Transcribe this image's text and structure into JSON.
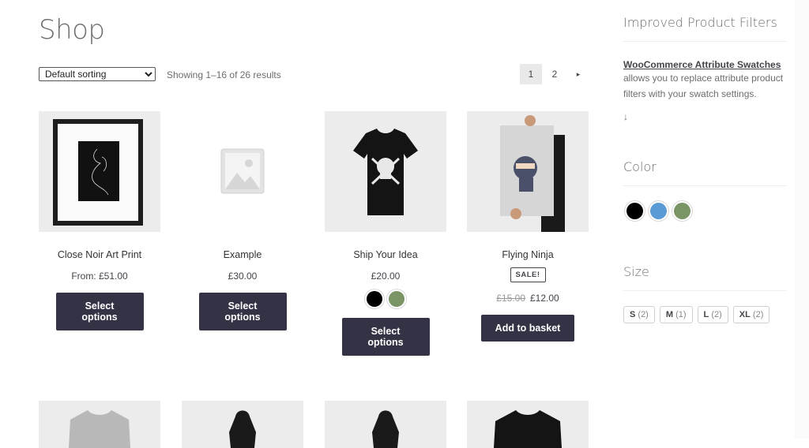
{
  "page": {
    "title": "Shop"
  },
  "toolbar": {
    "sort_selected": "Default sorting",
    "sort_options": [
      "Default sorting"
    ],
    "result_count": "Showing 1–16 of 26 results",
    "pages": [
      "1",
      "2"
    ],
    "next": "▸"
  },
  "products": [
    {
      "title": "Close Noir Art Print",
      "price": "From: £51.00",
      "button": "Select options"
    },
    {
      "title": "Example",
      "price": "£30.00",
      "button": "Select options"
    },
    {
      "title": "Ship Your Idea",
      "price": "£20.00",
      "button": "Select options",
      "swatches": [
        "#000000",
        "#7a9466"
      ]
    },
    {
      "title": "Flying Ninja",
      "badge": "SALE!",
      "old_price": "£15.00",
      "price": "£12.00",
      "button": "Add to basket"
    }
  ],
  "sidebar": {
    "filters_title": "Improved Product Filters",
    "filters_link": "WooCommerce Attribute Swatches",
    "filters_text": "allows you to replace attribute product filters with your swatch settings.",
    "filters_arrow": "↓",
    "color_title": "Color",
    "colors": [
      "#000000",
      "#5b9bd5",
      "#7a9466"
    ],
    "size_title": "Size",
    "sizes": [
      {
        "label": "S",
        "count": "(2)"
      },
      {
        "label": "M",
        "count": "(1)"
      },
      {
        "label": "L",
        "count": "(2)"
      },
      {
        "label": "XL",
        "count": "(2)"
      }
    ]
  }
}
